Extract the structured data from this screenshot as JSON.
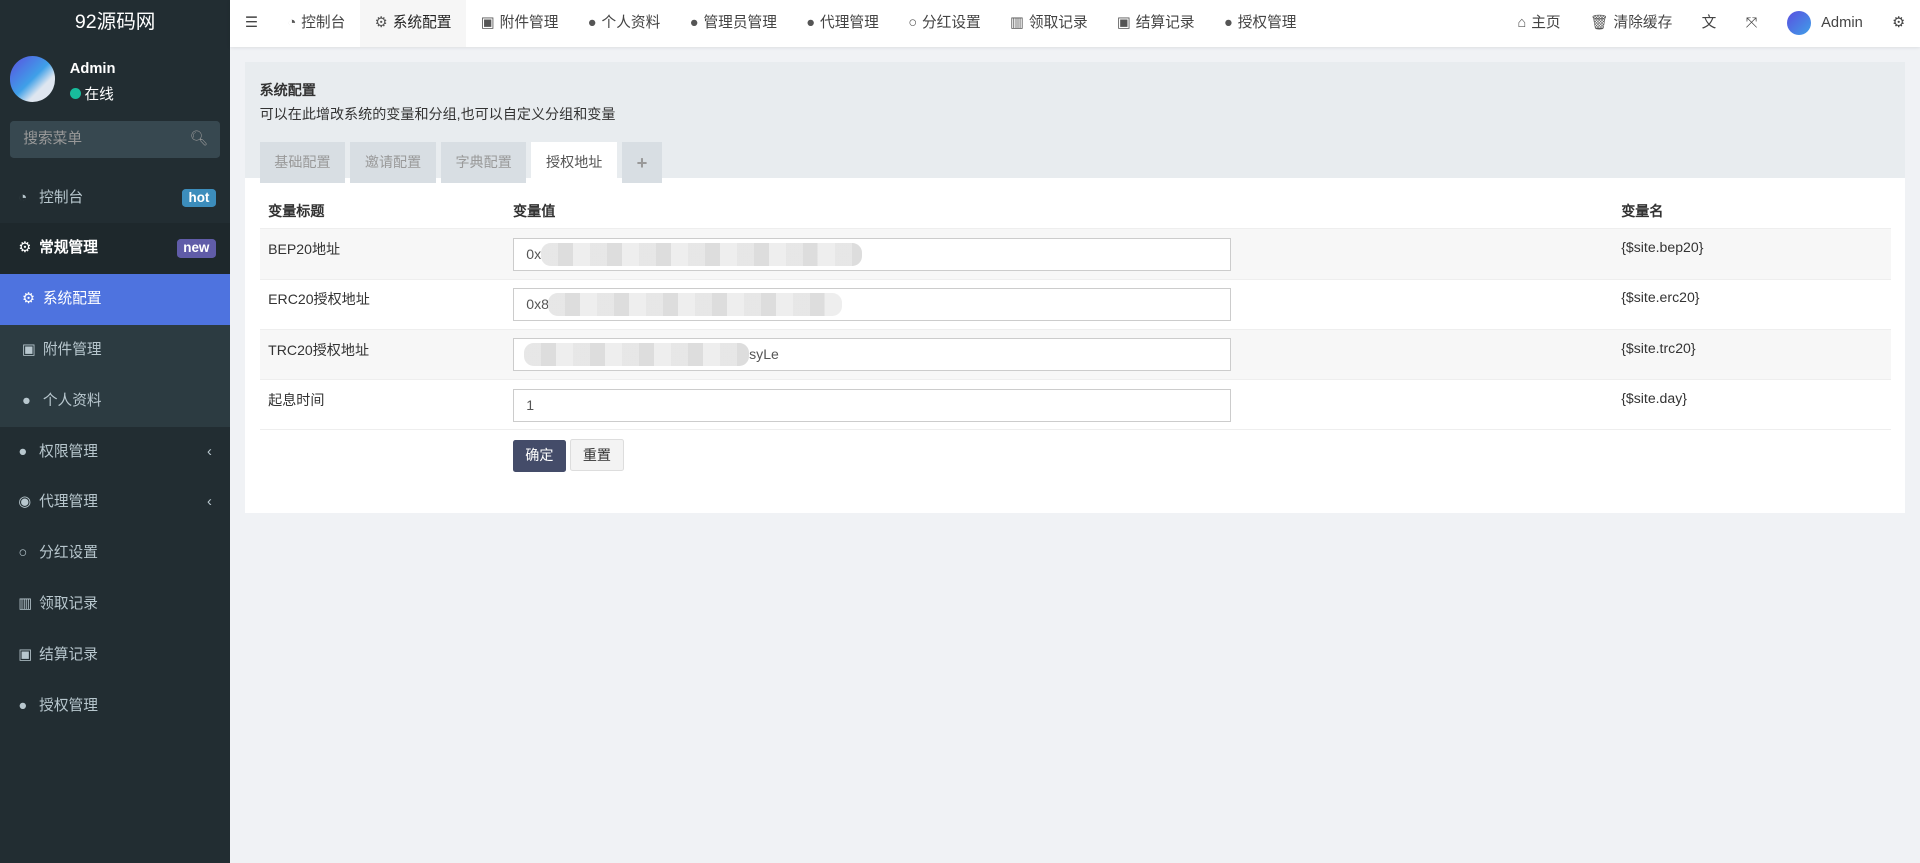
{
  "sidebar": {
    "logo": "92源码网",
    "user": {
      "name": "Admin",
      "status": "在线"
    },
    "search_placeholder": "搜索菜单",
    "items": [
      {
        "label": "控制台",
        "icon": "dashboard-icon",
        "badge": "hot",
        "badge_color": "#3c8dbc"
      },
      {
        "label": "常规管理",
        "icon": "cogs-icon",
        "badge": "new",
        "badge_color": "#605ca8"
      },
      {
        "label": "系统配置",
        "icon": "gear-icon"
      },
      {
        "label": "附件管理",
        "icon": "file-image-icon"
      },
      {
        "label": "个人资料",
        "icon": "user-icon"
      },
      {
        "label": "权限管理",
        "icon": "group-icon"
      },
      {
        "label": "代理管理",
        "icon": "user-circle-icon"
      },
      {
        "label": "分红设置",
        "icon": "circle-icon"
      },
      {
        "label": "领取记录",
        "icon": "chart-icon"
      },
      {
        "label": "结算记录",
        "icon": "cc-icon"
      },
      {
        "label": "授权管理",
        "icon": "group-icon"
      }
    ]
  },
  "topnav": {
    "tabs": [
      "控制台",
      "系统配置",
      "附件管理",
      "个人资料",
      "管理员管理",
      "代理管理",
      "分红设置",
      "领取记录",
      "结算记录",
      "授权管理"
    ],
    "right": {
      "home": "主页",
      "clear_cache": "清除缓存",
      "user": "Admin"
    }
  },
  "panel": {
    "title": "系统配置",
    "description": "可以在此增改系统的变量和分组,也可以自定义分组和变量",
    "tabs": [
      "基础配置",
      "邀请配置",
      "字典配置",
      "授权地址",
      "+"
    ],
    "columns": [
      "变量标题",
      "变量值",
      "变量名"
    ],
    "rows": [
      {
        "title": "BEP20地址",
        "value": "0x",
        "name": "{$site.bep20}"
      },
      {
        "title": "ERC20授权地址",
        "value": "0x8",
        "name": "{$site.erc20}"
      },
      {
        "title": "TRC20授权地址",
        "value": "syLe",
        "name": "{$site.trc20}"
      },
      {
        "title": "起息时间",
        "value": "1",
        "name": "{$site.day}"
      }
    ],
    "submit": "确定",
    "reset": "重置"
  }
}
